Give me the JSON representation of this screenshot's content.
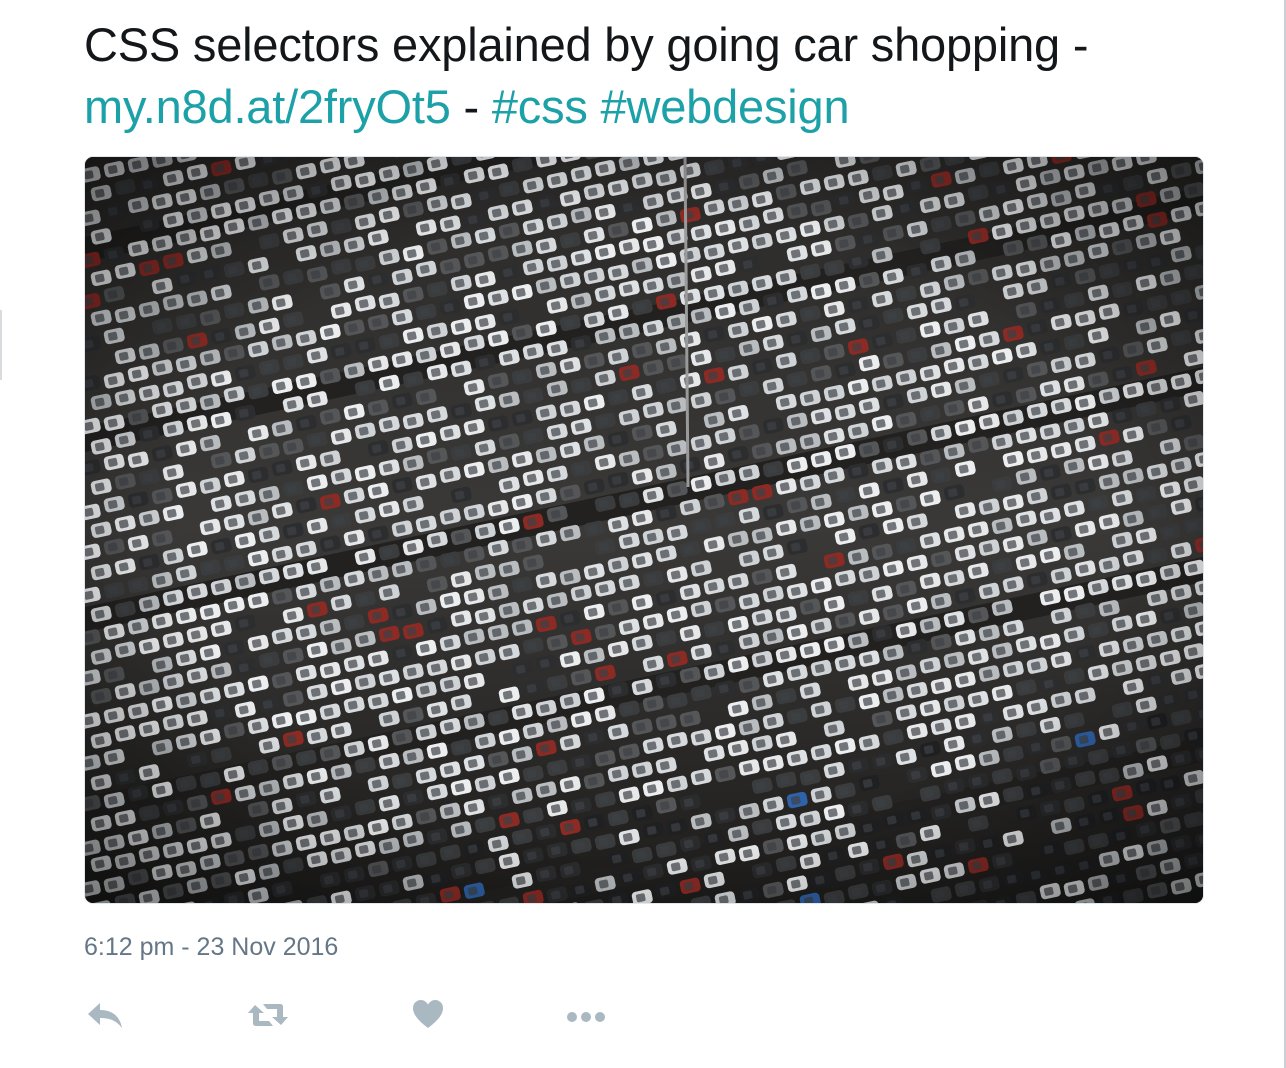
{
  "tweet": {
    "text_lead": "CSS selectors explained by going car shopping -",
    "link": "my.n8d.at/2fryOt5",
    "separator": " - ",
    "hashtag_1": "#css",
    "hashtag_2": "#webdesign",
    "timestamp": "6:12 pm - 23 Nov 2016"
  },
  "media": {
    "icon": "parking-lot-photo"
  },
  "actions": {
    "reply": "reply-icon",
    "retweet": "retweet-icon",
    "like": "heart-icon",
    "more": "more-icon"
  },
  "colors": {
    "link": "#1da1a8",
    "text": "#14171a",
    "muted": "#657786",
    "icon": "#aab8c2"
  }
}
